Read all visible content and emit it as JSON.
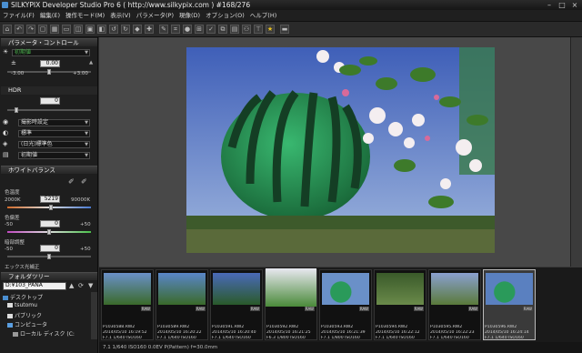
{
  "window": {
    "title": "SILKYPIX Developer Studio Pro 6 ( http://www.silkypix.com )   #168/276"
  },
  "menu": [
    "ファイル(F)",
    "編集(E)",
    "操作モード(M)",
    "表示(V)",
    "パラメータ(P)",
    "現像(D)",
    "オプション(O)",
    "ヘルプ(H)"
  ],
  "panel": {
    "param_header": "パラメータ・コントロール",
    "exposure_preset": "初期値",
    "exposure_value": "0.00",
    "exposure_min": "-3.00",
    "exposure_max": "+3.00",
    "hdr_label": "HDR",
    "hdr_value": "0",
    "taste_preset": "撮影時設定",
    "color_preset": "標準",
    "skin_preset": "(日光)標準色",
    "sharp_preset": "初期値",
    "wb_header": "ホワイトバランス",
    "temp_label": "色温度",
    "temp_min": "2000K",
    "temp_value": "5219",
    "temp_max": "90000K",
    "dev_label": "色偏差",
    "dev_min": "-50",
    "dev_value": "0",
    "dev_max": "+50",
    "tone_label": "暗部調整",
    "tone_min": "-50",
    "tone_value": "0",
    "tone_max": "+50",
    "exp2_label": "エックス光補正",
    "folder_header": "フォルダツリー",
    "path_value": "D:¥103_PANA",
    "tree": [
      "デスクトップ",
      "tsutomu",
      "パブリック",
      "コンピュータ",
      "ローカル ディスク (C:"
    ]
  },
  "filmstrip": [
    {
      "file": "P1030588.RW2",
      "date": "2014/05/10 16:19:52",
      "exif": "F7.1 1/640 ISO160"
    },
    {
      "file": "P1030589.RW2",
      "date": "2014/05/10 16:20:22",
      "exif": "F7.1 1/640 ISO160"
    },
    {
      "file": "P1030591.RW2",
      "date": "2014/05/10 16:20:40",
      "exif": "F7.1 1/640 ISO160"
    },
    {
      "file": "P1030592.RW2",
      "date": "2014/05/10 16:21:25",
      "exif": "F6.3 1/800 ISO160"
    },
    {
      "file": "P1030593.RW2",
      "date": "2014/05/10 16:21:39",
      "exif": "F7.1 1/800 ISO160"
    },
    {
      "file": "P1030594.RW2",
      "date": "2014/05/10 16:22:12",
      "exif": "F7.1 1/640 ISO160"
    },
    {
      "file": "P1030595.RW2",
      "date": "2014/05/10 16:22:23",
      "exif": "F7.1 1/640 ISO160"
    },
    {
      "file": "P1030596.RW2",
      "date": "2014/05/10 16:24:14",
      "exif": "F7.1 1/640 ISO160"
    }
  ],
  "status": "7.1 1/640 ISO160   0.0EV P(Pattern) f=30.0mm"
}
